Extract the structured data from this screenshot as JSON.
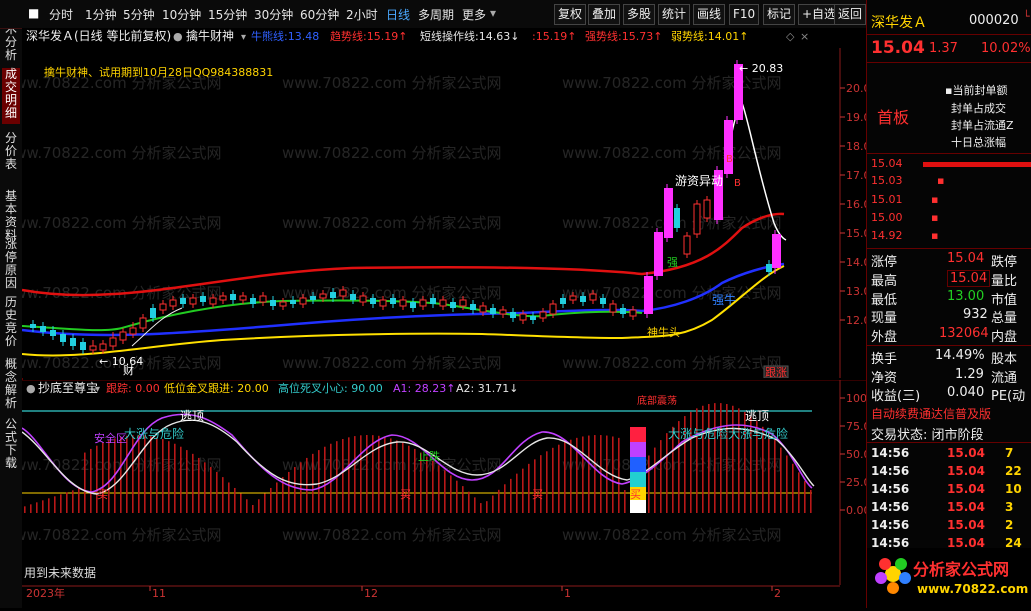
{
  "toolbar": {
    "periods": [
      "分时",
      "1分钟",
      "5分钟",
      "10分钟",
      "15分钟",
      "30分钟",
      "60分钟",
      "2小时",
      "日线",
      "多周期",
      "更多"
    ],
    "active_period": "日线",
    "buttons": [
      "复权",
      "叠加",
      "多股",
      "统计",
      "画线",
      "F10",
      "标记",
      "+自选",
      "返回"
    ]
  },
  "left_tabs": [
    "技术分析",
    "成交明细",
    "分价表",
    "基本资料",
    "涨停原因",
    "历史竞价",
    "概念解析",
    "公式下载"
  ],
  "main_chart": {
    "title": "深华发Ａ(日线 等比前复权)",
    "indicator_name": "擒牛财神",
    "line_labels": [
      {
        "text": "牛熊线:13.48",
        "color": "#3060ff"
      },
      {
        "text": "趋势线:15.19↑",
        "color": "#ff3030"
      },
      {
        "text": "短线操作线:14.63↓",
        "color": "#e6e6e6"
      },
      {
        "text": ":15.19↑",
        "color": "#ff3030"
      },
      {
        "text": "强势线:15.73↑",
        "color": "#ff3030"
      },
      {
        "text": "弱势线:14.01↑",
        "color": "#ffd400"
      }
    ],
    "trial_text": "擒牛财神、试用期到10月28日QQ984388831",
    "y_ticks": [
      "20.00",
      "19.00",
      "18.00",
      "17.00",
      "16.00",
      "15.00",
      "14.00",
      "13.00",
      "12.00"
    ],
    "annotations": {
      "high_price": "20.83",
      "low_price": "10.64",
      "cai": "财",
      "youzi": "游资异动",
      "qiang": "强",
      "qiangniu": "强牛",
      "shenniutou": "神牛头",
      "b_marks": [
        "B",
        "B"
      ],
      "gen_zhang": "跟涨"
    }
  },
  "indicator_chart": {
    "name": "抄底至尊宝",
    "params": [
      {
        "label": "跟踪: 0.00",
        "color": "#ff3030"
      },
      {
        "label": "低位金叉跟进: 20.00",
        "color": "#ffd400"
      },
      {
        "label": "高位死叉小心: 90.00",
        "color": "#3cc"
      },
      {
        "label": "A1: 28.23↑",
        "color": "#c040ff"
      },
      {
        "label": "A2: 31.71↓",
        "color": "#e6e6e6"
      }
    ],
    "y_ticks": [
      "100.00",
      "75.00",
      "50.00",
      "25.00",
      "0.00"
    ],
    "labels": {
      "taoding": "逃顶",
      "dazhang": "大涨与危险",
      "dazhang2": "大涨与危险大涨与危险",
      "anquan": "安全区",
      "zhi": "止跌",
      "mai": "买",
      "zhendang": "底部震荡"
    },
    "future_data": "用到未来数据"
  },
  "x_axis": [
    "2023年",
    "11",
    "12",
    "1",
    "2"
  ],
  "right_panel": {
    "stock_name": "深华发Ａ",
    "stock_code": "000020",
    "price": "15.04",
    "change": "1.37",
    "pct": "10.02%",
    "tag": "首板",
    "seal_info": [
      "当前封单额",
      "封单占成交",
      "封单占流通Z",
      "十日总涨幅"
    ],
    "order_prices": [
      "15.04",
      "15.03",
      "15.01",
      "15.00",
      "14.92"
    ],
    "stats": [
      {
        "k": "涨停",
        "v": "15.04",
        "k2": "跌停"
      },
      {
        "k": "最高",
        "v": "15.04",
        "k2": "量比"
      },
      {
        "k": "最低",
        "v": "13.00",
        "k2": "市值"
      },
      {
        "k": "现量",
        "v": "932",
        "k2": "总量"
      },
      {
        "k": "外盘",
        "v": "132064",
        "k2": "内盘"
      }
    ],
    "stats2": [
      {
        "k": "换手",
        "v": "14.49%",
        "k2": "股本"
      },
      {
        "k": "净资",
        "v": "1.29",
        "k2": "流通"
      },
      {
        "k": "收益(三)",
        "v": "0.040",
        "k2": "PE(动"
      }
    ],
    "notice": "自动续费通达信普及版",
    "trade_state": "交易状态: 闭市阶段",
    "ticks": [
      {
        "t": "14:56",
        "p": "15.04",
        "v": "7"
      },
      {
        "t": "14:56",
        "p": "15.04",
        "v": "22"
      },
      {
        "t": "14:56",
        "p": "15.04",
        "v": "10"
      },
      {
        "t": "14:56",
        "p": "15.04",
        "v": "3"
      },
      {
        "t": "14:56",
        "p": "15.04",
        "v": "2"
      },
      {
        "t": "14:56",
        "p": "15.04",
        "v": "24"
      }
    ],
    "logo_text": "分析家公式网",
    "logo_url": "www.70822.com"
  },
  "watermark": "www.70822.com 分析家公式网"
}
